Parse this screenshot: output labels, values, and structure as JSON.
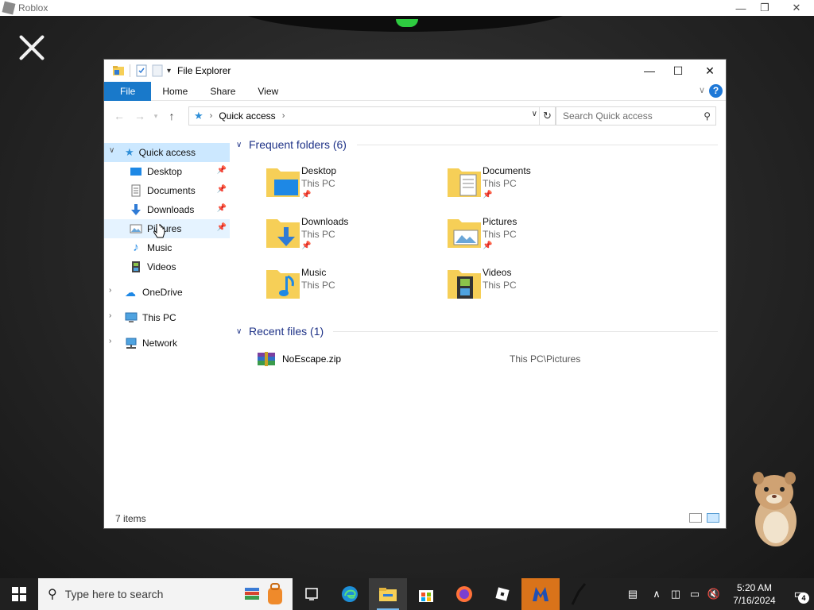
{
  "roblox": {
    "title": "Roblox"
  },
  "explorer": {
    "title": "File Explorer",
    "ribbon_tabs": [
      "File",
      "Home",
      "Share",
      "View"
    ],
    "address": {
      "location": "Quick access"
    },
    "search_placeholder": "Search Quick access",
    "nav": {
      "quick_access": "Quick access",
      "pinned": [
        {
          "label": "Desktop",
          "icon": "desktop-icon",
          "pinned": true
        },
        {
          "label": "Documents",
          "icon": "documents-icon",
          "pinned": true
        },
        {
          "label": "Downloads",
          "icon": "downloads-icon",
          "pinned": true
        },
        {
          "label": "Pictures",
          "icon": "pictures-icon",
          "pinned": true
        },
        {
          "label": "Music",
          "icon": "music-icon",
          "pinned": false
        },
        {
          "label": "Videos",
          "icon": "videos-icon",
          "pinned": false
        }
      ],
      "roots": [
        {
          "label": "OneDrive",
          "icon": "onedrive-icon"
        },
        {
          "label": "This PC",
          "icon": "this-pc-icon"
        },
        {
          "label": "Network",
          "icon": "network-icon"
        }
      ]
    },
    "frequent": {
      "header": "Frequent folders (6)",
      "folders": [
        {
          "name": "Desktop",
          "location": "This PC",
          "pinned": true
        },
        {
          "name": "Documents",
          "location": "This PC",
          "pinned": true
        },
        {
          "name": "Downloads",
          "location": "This PC",
          "pinned": true
        },
        {
          "name": "Pictures",
          "location": "This PC",
          "pinned": true
        },
        {
          "name": "Music",
          "location": "This PC",
          "pinned": false
        },
        {
          "name": "Videos",
          "location": "This PC",
          "pinned": false
        }
      ]
    },
    "recent": {
      "header": "Recent files (1)",
      "files": [
        {
          "name": "NoEscape.zip",
          "location": "This PC\\Pictures"
        }
      ]
    },
    "status": "7 items"
  },
  "taskbar": {
    "search_placeholder": "Type here to search",
    "time": "5:20 AM",
    "date": "7/16/2024",
    "notifications": "4",
    "apps": [
      "task-view-icon",
      "edge-icon",
      "file-explorer-icon",
      "store-icon",
      "firefox-icon",
      "roblox-icon",
      "malwarebytes-icon",
      "pen-icon"
    ]
  },
  "colors": {
    "accent": "#1979ca",
    "selected": "#cce8ff",
    "group_header": "#1e3287",
    "taskbar": "#202020"
  }
}
